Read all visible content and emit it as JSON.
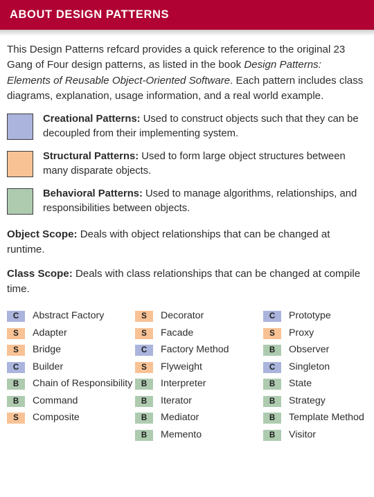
{
  "header": {
    "title": "About Design Patterns",
    "background_color": "#b00233",
    "text_color": "#ffffff"
  },
  "intro": {
    "part1": "This Design Patterns refcard provides a quick reference to the original 23 Gang of Four design patterns, as listed in the book ",
    "book_title": "Design Patterns: Elements of Reusable Object-Oriented Software",
    "part2": ". Each pattern includes class diagrams, explanation, usage information, and a real world example."
  },
  "legend": [
    {
      "swatch_name": "creational-swatch",
      "color": "#aab4dc",
      "label": "Creational Patterns:",
      "description": " Used to construct objects such that they can be decoupled from their implementing system."
    },
    {
      "swatch_name": "structural-swatch",
      "color": "#f8c295",
      "label": "Structural Patterns:",
      "description": " Used to form large object structures between many disparate objects."
    },
    {
      "swatch_name": "behavioral-swatch",
      "color": "#aecbb0",
      "label": "Behavioral Patterns:",
      "description": " Used to manage algorithms, relationships, and responsibilities between objects."
    }
  ],
  "scopes": [
    {
      "label": "Object Scope:",
      "description": " Deals with object relationships that can be changed at runtime."
    },
    {
      "label": "Class Scope:",
      "description": " Deals with class relationships that can be changed at compile time."
    }
  ],
  "badge_colors": {
    "C": "#aab4dc",
    "S": "#f8c295",
    "B": "#aecbb0"
  },
  "pattern_columns": [
    [
      {
        "badge": "C",
        "name": "Abstract Factory"
      },
      {
        "badge": "S",
        "name": "Adapter"
      },
      {
        "badge": "S",
        "name": "Bridge"
      },
      {
        "badge": "C",
        "name": "Builder"
      },
      {
        "badge": "B",
        "name": "Chain of Responsibility"
      },
      {
        "badge": "B",
        "name": "Command"
      },
      {
        "badge": "S",
        "name": "Composite"
      }
    ],
    [
      {
        "badge": "S",
        "name": "Decorator"
      },
      {
        "badge": "S",
        "name": "Facade"
      },
      {
        "badge": "C",
        "name": "Factory Method"
      },
      {
        "badge": "S",
        "name": "Flyweight"
      },
      {
        "badge": "B",
        "name": "Interpreter"
      },
      {
        "badge": "B",
        "name": "Iterator"
      },
      {
        "badge": "B",
        "name": "Mediator"
      },
      {
        "badge": "B",
        "name": "Memento"
      }
    ],
    [
      {
        "badge": "C",
        "name": "Prototype"
      },
      {
        "badge": "S",
        "name": "Proxy"
      },
      {
        "badge": "B",
        "name": "Observer"
      },
      {
        "badge": "C",
        "name": "Singleton"
      },
      {
        "badge": "B",
        "name": "State"
      },
      {
        "badge": "B",
        "name": "Strategy"
      },
      {
        "badge": "B",
        "name": "Template Method"
      },
      {
        "badge": "B",
        "name": "Visitor"
      }
    ]
  ]
}
